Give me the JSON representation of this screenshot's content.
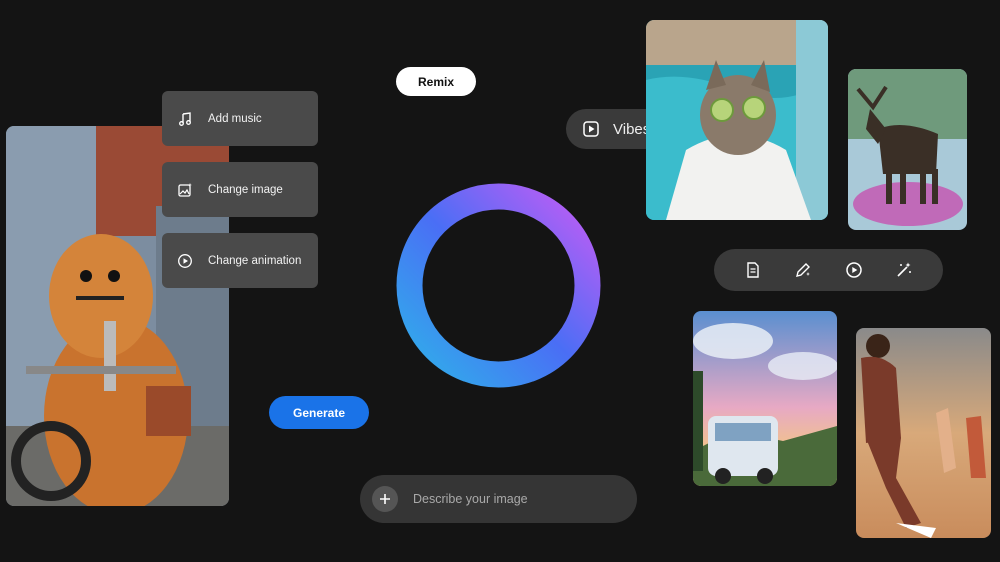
{
  "menu": {
    "items": [
      {
        "label": "Add music",
        "icon": "music-note-icon"
      },
      {
        "label": "Change image",
        "icon": "image-edit-icon"
      },
      {
        "label": "Change animation",
        "icon": "play-circle-icon"
      }
    ]
  },
  "remix": {
    "label": "Remix"
  },
  "vibes": {
    "label": "Vibes",
    "icon": "play-square-icon"
  },
  "generate": {
    "label": "Generate"
  },
  "prompt": {
    "placeholder": "Describe your image",
    "plus_icon": "plus-icon"
  },
  "toolbar": {
    "icons": [
      "document-icon",
      "pencil-sparkle-icon",
      "play-circle-icon",
      "magic-wand-icon"
    ]
  },
  "images": [
    {
      "name": "furry-monster-motorcycle-image"
    },
    {
      "name": "cat-cucumber-eyes-image"
    },
    {
      "name": "moose-on-platform-image"
    },
    {
      "name": "anime-van-sunset-image"
    },
    {
      "name": "soccer-players-image"
    }
  ],
  "colors": {
    "background": "#141414",
    "accent_blue": "#1a73e8",
    "ring_gradient": [
      "#c45cf5",
      "#4a6ef5",
      "#2fb0ea"
    ]
  }
}
